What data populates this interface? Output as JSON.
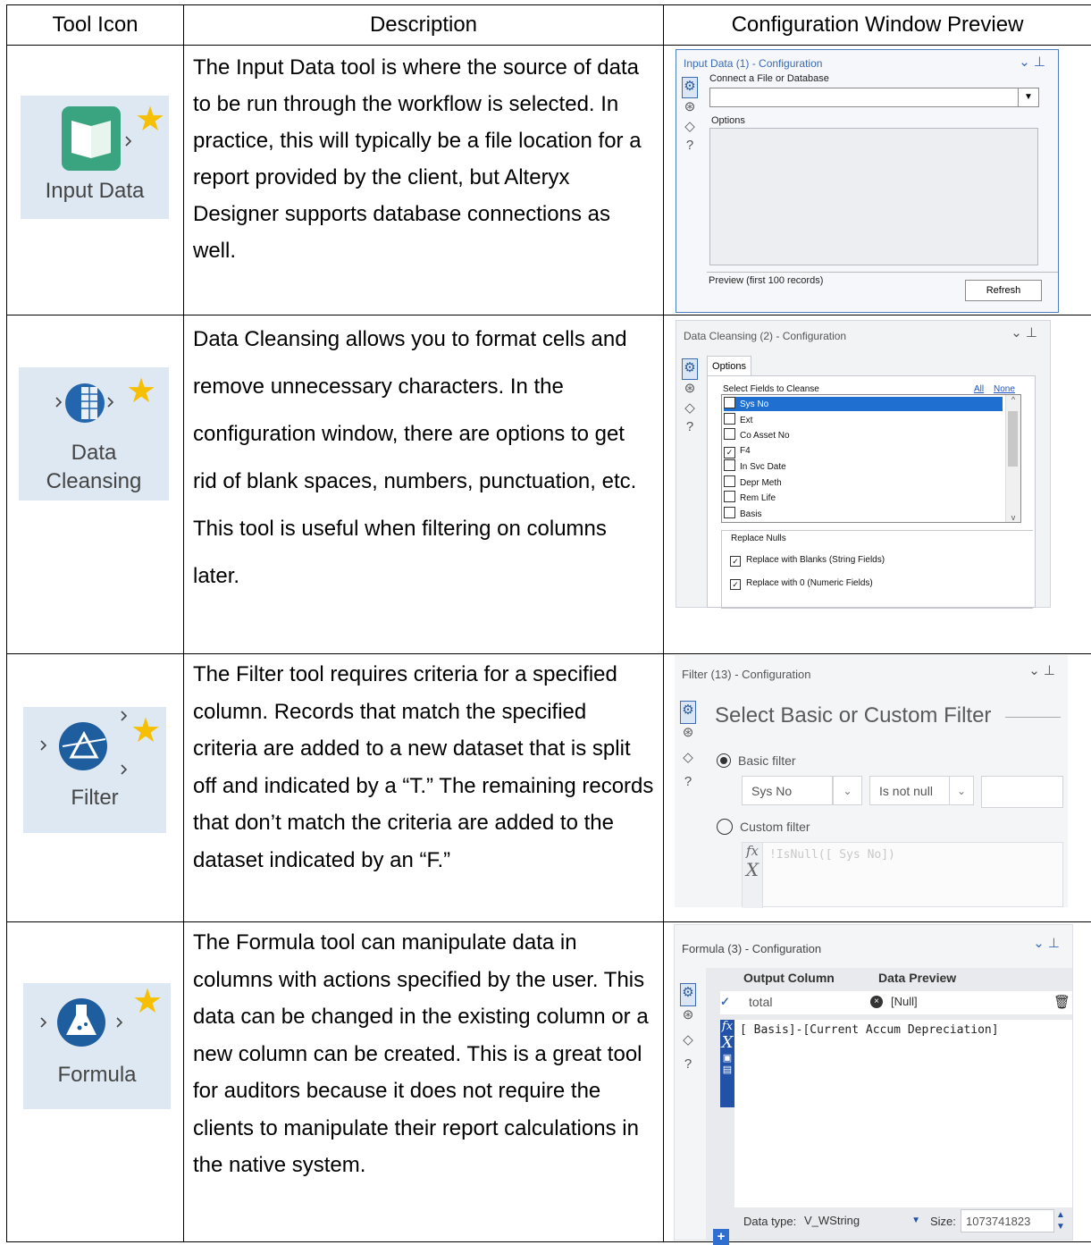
{
  "headers": [
    "Tool Icon",
    "Description",
    "Configuration Window Preview"
  ],
  "rows": [
    {
      "icon_label": "Input Data",
      "description": "The Input Data tool is where the source of data to be run through the workflow is selected. In practice, this will typically be a file location for a report provided by the client, but Alteryx Designer supports database connections as well.",
      "config": {
        "title": "Input Data (1) - Configuration",
        "connect_label": "Connect a File or Database",
        "options_label": "Options",
        "preview_label": "Preview (first 100 records)",
        "refresh_label": "Refresh"
      }
    },
    {
      "icon_label_1": "Data",
      "icon_label_2": "Cleansing",
      "description": "Data Cleansing allows you to format cells and remove unnecessary characters. In the configuration window, there are options to get rid of blank spaces, numbers, punctuation, etc. This tool is useful when filtering on columns later.",
      "config": {
        "title": "Data Cleansing (2) - Configuration",
        "tab_label": "Options",
        "fields_label": "Select Fields to Cleanse",
        "all_label": "All",
        "none_label": "None",
        "fields": [
          {
            "name": "Sys No",
            "checked": false,
            "selected": true
          },
          {
            "name": "Ext",
            "checked": false,
            "selected": false
          },
          {
            "name": "Co Asset No",
            "checked": false,
            "selected": false
          },
          {
            "name": "F4",
            "checked": true,
            "selected": false
          },
          {
            "name": "In Svc  Date",
            "checked": false,
            "selected": false
          },
          {
            "name": "Depr  Meth",
            "checked": false,
            "selected": false
          },
          {
            "name": "Rem  Life",
            "checked": false,
            "selected": false
          },
          {
            "name": "Basis",
            "checked": false,
            "selected": false
          }
        ],
        "replace_nulls_label": "Replace Nulls",
        "replace_blanks_label": "Replace with Blanks (String Fields)",
        "replace_zero_label": "Replace with 0 (Numeric Fields)"
      }
    },
    {
      "icon_label": "Filter",
      "description": "The Filter tool requires criteria for a specified column. Records that match the specified criteria are added to a new dataset that is split off and indicated by a “T.” The remaining records that don’t match the criteria are added to the dataset indicated by an “F.”",
      "config": {
        "title": "Filter (13) - Configuration",
        "heading": "Select Basic or Custom Filter",
        "basic_label": "Basic filter",
        "field_value": "Sys No",
        "operator_value": "Is not null",
        "custom_label": "Custom filter",
        "expression": "!IsNull([  Sys No])"
      }
    },
    {
      "icon_label": "Formula",
      "description": "The Formula tool can manipulate data in columns with actions specified by the user. This data can be changed in the existing column or a new column can be created. This is a great tool for auditors because it does not require the clients to manipulate their report calculations in the native system.",
      "config": {
        "title": "Formula (3) - Configuration",
        "col_output": "Output Column",
        "col_preview": "Data Preview",
        "output_value": "total",
        "preview_value": "[Null]",
        "expression": "[  Basis]-[Current Accum  Depreciation]",
        "datatype_label": "Data type:",
        "datatype_value": "V_WString",
        "size_label": "Size:",
        "size_value": "1073741823"
      }
    }
  ]
}
